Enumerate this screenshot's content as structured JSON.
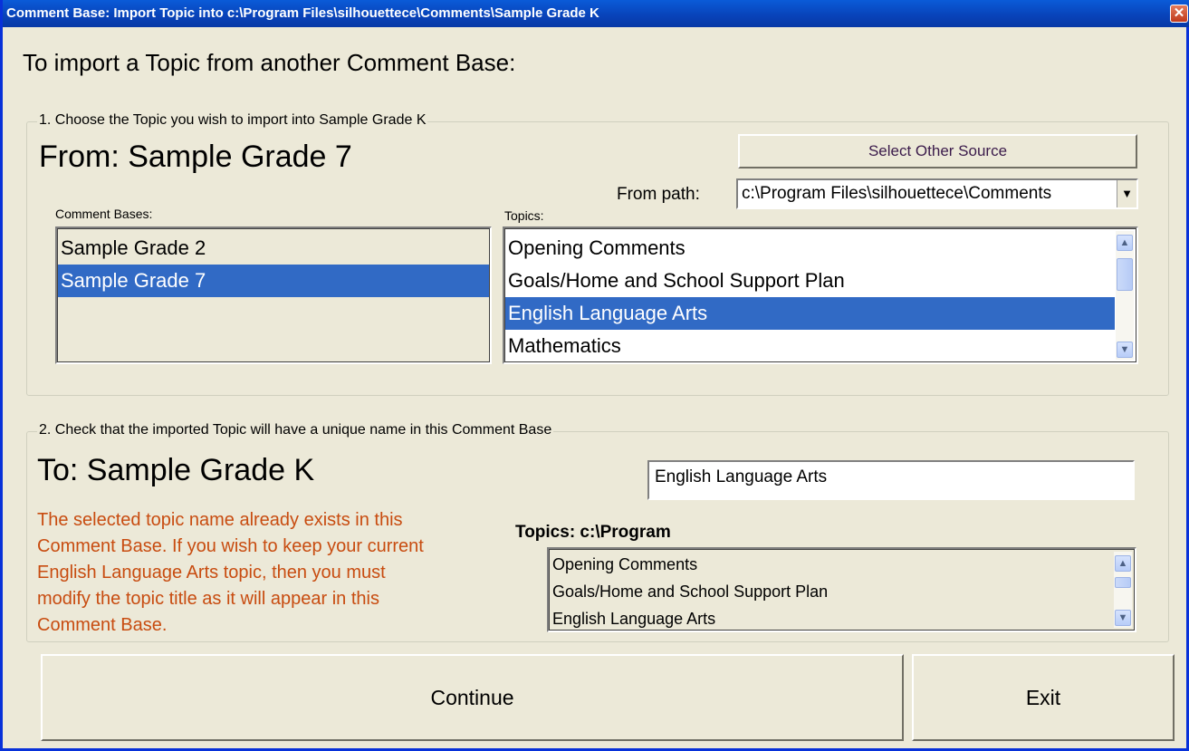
{
  "window": {
    "title": "Comment Base: Import Topic into c:\\Program Files\\silhouettece\\Comments\\Sample Grade K",
    "close_glyph": "✕"
  },
  "heading": "To import a Topic from another Comment Base:",
  "section1": {
    "legend": "1. Choose the Topic you wish to import into Sample Grade K",
    "from_title": "From: Sample Grade 7",
    "select_source_label": "Select Other Source",
    "comment_bases_label": "Comment Bases:",
    "comment_bases": [
      {
        "label": "Sample Grade 2",
        "selected": false
      },
      {
        "label": "Sample Grade 7",
        "selected": true
      }
    ],
    "topics_label": "Topics:",
    "from_path_label": "From path:",
    "from_path_value": "c:\\Program Files\\silhouettece\\Comments",
    "topics": [
      {
        "label": "Opening Comments",
        "selected": false
      },
      {
        "label": "Goals/Home and School Support Plan",
        "selected": false
      },
      {
        "label": "English Language Arts",
        "selected": true
      },
      {
        "label": "Mathematics",
        "selected": false
      }
    ]
  },
  "section2": {
    "legend": "2. Check that the imported Topic will have a unique name in this Comment Base",
    "to_title": "To: Sample Grade K",
    "topic_name_value": "English Language Arts",
    "warning": "The selected topic name already exists in this Comment Base. If you wish to keep your current English Language Arts topic, then you must modify the topic title as it will appear in this Comment Base.",
    "topics_header": "Topics: c:\\Program",
    "topics": [
      "Opening Comments",
      "Goals/Home and School Support Plan",
      "English Language Arts"
    ]
  },
  "buttons": {
    "continue": "Continue",
    "exit": "Exit"
  },
  "icons": {
    "scroll_up": "chevron-up-icon",
    "scroll_down": "chevron-down-icon",
    "dropdown": "triangle-down-icon",
    "close": "close-icon"
  },
  "colors": {
    "titlebar": "#0842b8",
    "selection": "#316ac5",
    "warning_text": "#c84c10",
    "face": "#ece9d8"
  }
}
